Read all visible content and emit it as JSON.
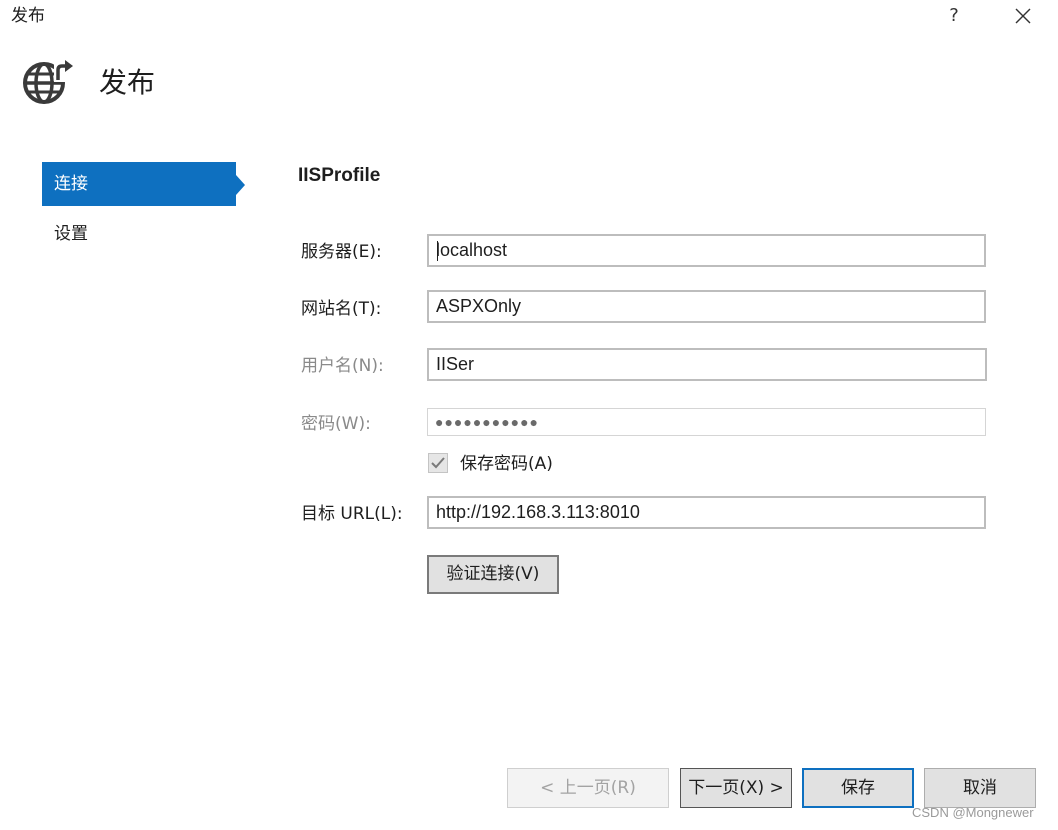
{
  "window": {
    "title": "发布",
    "help_label": "?"
  },
  "header": {
    "title": "发布",
    "icon": "globe-publish-icon"
  },
  "nav": {
    "items": [
      {
        "label": "连接",
        "active": true
      },
      {
        "label": "设置",
        "active": false
      }
    ]
  },
  "profile": {
    "name": "IISProfile"
  },
  "form": {
    "server": {
      "label": "服务器(E):",
      "value": "localhost"
    },
    "site_name": {
      "label": "网站名(T):",
      "value": "ASPXOnly"
    },
    "username": {
      "label": "用户名(N):",
      "value": "IISer"
    },
    "password": {
      "label": "密码(W):",
      "value": "●●●●●●●●●●●"
    },
    "save_password": {
      "label": "保存密码(A)",
      "checked": true
    },
    "target_url": {
      "label": "目标 URL(L):",
      "value": "http://192.168.3.113:8010"
    },
    "verify_label": "验证连接(V)"
  },
  "footer": {
    "prev_label": "< 上一页(R)",
    "next_label": "下一页(X) >",
    "save_label": "保存",
    "cancel_label": "取消"
  },
  "watermark": "CSDN @Mongnewer",
  "colors": {
    "accent": "#0e70c0",
    "disabled_text": "#8a8a8a",
    "button_face": "#e1e1e1"
  }
}
